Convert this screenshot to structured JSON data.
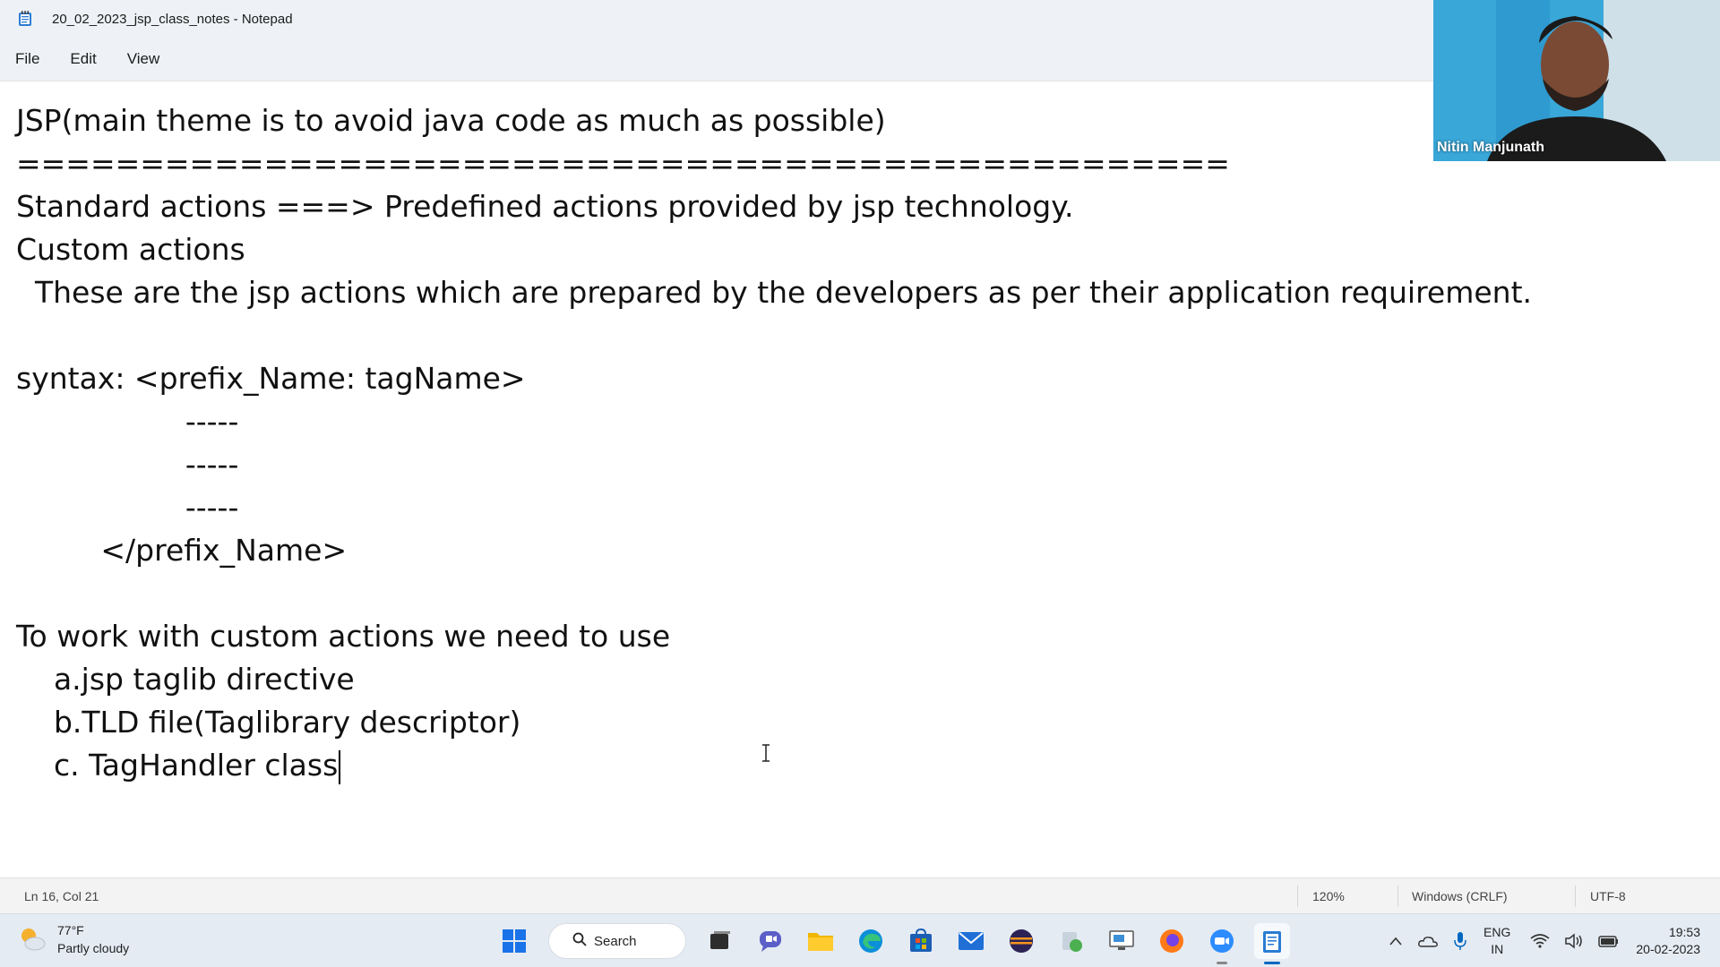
{
  "window": {
    "title": "20_02_2023_jsp_class_notes - Notepad"
  },
  "menu": {
    "file": "File",
    "edit": "Edit",
    "view": "View"
  },
  "editor": {
    "lines": [
      "JSP(main theme is to avoid java code as much as possible)",
      "=================================================",
      "Standard actions ===> Predefined actions provided by jsp technology.",
      "Custom actions",
      "  These are the jsp actions which are prepared by the developers as per their application requirement.",
      "",
      "syntax: <prefix_Name: tagName>",
      "                  -----",
      "                  -----",
      "                  -----",
      "         </prefix_Name>",
      "",
      "To work with custom actions we need to use",
      "    a.jsp taglib directive",
      "    b.TLD file(Taglibrary descriptor)",
      "    c. TagHandler class"
    ]
  },
  "webcam": {
    "participant_name": "Nitin Manjunath"
  },
  "status_bar": {
    "position": "Ln 16, Col 21",
    "zoom": "120%",
    "line_ending": "Windows (CRLF)",
    "encoding": "UTF-8"
  },
  "taskbar": {
    "weather_temp": "77°F",
    "weather_desc": "Partly cloudy",
    "search_label": "Search",
    "lang_line1": "ENG",
    "lang_line2": "IN",
    "time": "19:53",
    "date": "20-02-2023"
  },
  "colors": {
    "titlebar_bg": "#eef2f6",
    "taskbar_bg": "#e4ebf3",
    "accent": "#0067c0"
  }
}
